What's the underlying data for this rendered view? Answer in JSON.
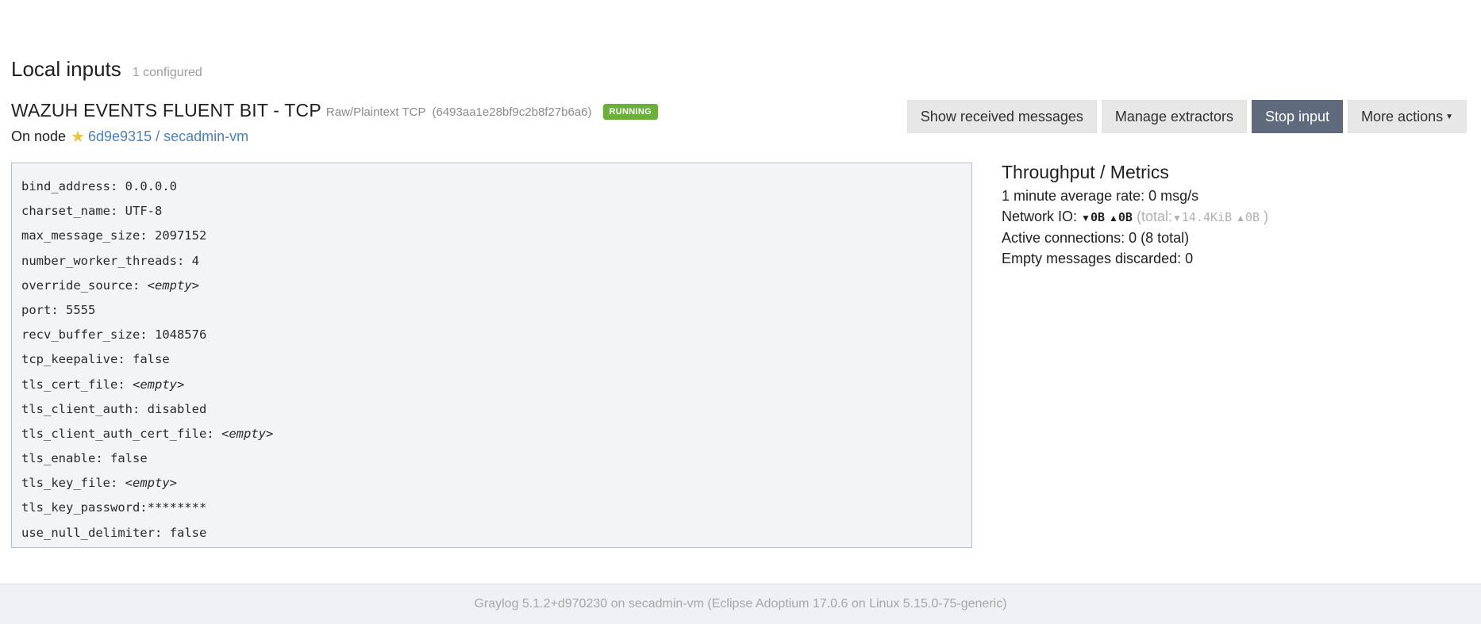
{
  "section": {
    "title": "Local inputs",
    "count": "1 configured"
  },
  "input": {
    "name": "WAZUH EVENTS FLUENT BIT - TCP",
    "type": "Raw/Plaintext TCP",
    "id": "(6493aa1e28bf9c2b8f27b6a6)",
    "status": "RUNNING",
    "node_prefix": "On node",
    "node_link": "6d9e9315 / secadmin-vm"
  },
  "actions": {
    "show_messages": "Show received messages",
    "manage_extractors": "Manage extractors",
    "stop_input": "Stop input",
    "more_actions": "More actions"
  },
  "config": [
    {
      "key": "bind_address:",
      "value": "0.0.0.0",
      "empty": false
    },
    {
      "key": "charset_name:",
      "value": "UTF-8",
      "empty": false
    },
    {
      "key": "max_message_size:",
      "value": "2097152",
      "empty": false
    },
    {
      "key": "number_worker_threads:",
      "value": "4",
      "empty": false
    },
    {
      "key": "override_source:",
      "value": "<empty>",
      "empty": true
    },
    {
      "key": "port:",
      "value": "5555",
      "empty": false
    },
    {
      "key": "recv_buffer_size:",
      "value": "1048576",
      "empty": false
    },
    {
      "key": "tcp_keepalive:",
      "value": "false",
      "empty": false
    },
    {
      "key": "tls_cert_file:",
      "value": "<empty>",
      "empty": true
    },
    {
      "key": "tls_client_auth:",
      "value": "disabled",
      "empty": false
    },
    {
      "key": "tls_client_auth_cert_file:",
      "value": "<empty>",
      "empty": true
    },
    {
      "key": "tls_enable:",
      "value": "false",
      "empty": false
    },
    {
      "key": "tls_key_file:",
      "value": "<empty>",
      "empty": true
    },
    {
      "key": "tls_key_password:",
      "value": "********",
      "empty": false,
      "nospace": true
    },
    {
      "key": "use_null_delimiter:",
      "value": "false",
      "empty": false
    }
  ],
  "metrics": {
    "title": "Throughput / Metrics",
    "avg_rate": "1 minute average rate: 0 msg/s",
    "network_label": "Network IO:",
    "net_down": "0B",
    "net_up": "0B",
    "total_open": "(total:",
    "total_down": "14.4KiB",
    "total_up": "0B",
    "total_close": ")",
    "active_connections": "Active connections: 0 (8 total)",
    "empty_discarded": "Empty messages discarded: 0"
  },
  "footer": {
    "text": "Graylog 5.1.2+d970230 on secadmin-vm (Eclipse Adoptium 17.0.6 on Linux 5.15.0-75-generic)"
  },
  "colors": {
    "running_badge": "#6ab03a",
    "primary_button": "#5f6b7c",
    "link": "#4a7fc2",
    "star": "#e8c53a"
  }
}
